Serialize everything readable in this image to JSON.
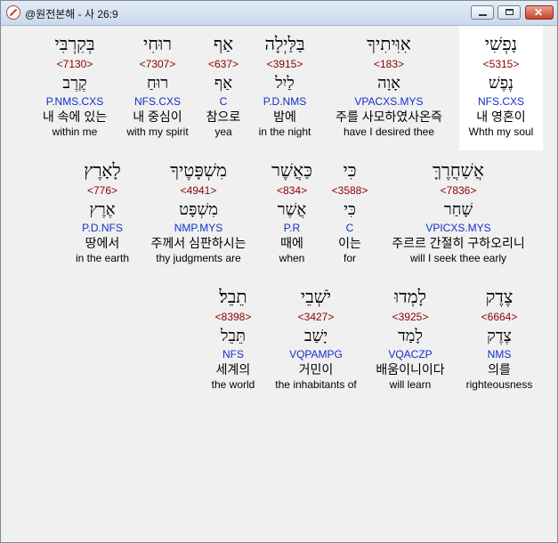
{
  "window": {
    "title": "@원전본해 - 사 26:9"
  },
  "rows": [
    [
      {
        "heb": "בְּקִרְבִּי",
        "num": "<7130>",
        "root": "קֶרֶב",
        "parse": "P.NMS.CXS",
        "kor": "내 속에 있는",
        "eng": "within me"
      },
      {
        "heb": "רוּחִי",
        "num": "<7307>",
        "root": "רוּחַ",
        "parse": "NFS.CXS",
        "kor": "내 중심이",
        "eng": "with my spirit"
      },
      {
        "heb": "אַף",
        "num": "<637>",
        "root": "אַף",
        "parse": "C",
        "kor": "참으로",
        "eng": "yea"
      },
      {
        "heb": "בַּלַּיְלָה",
        "num": "<3915>",
        "root": "לַיִל",
        "parse": "P.D.NMS",
        "kor": "밤에",
        "eng": "in the night"
      },
      {
        "heb": "אִוִּיתִיךָ",
        "num": "<183>",
        "root": "אָוָה",
        "parse": "VPACXS.MYS",
        "kor": "주를 사모하였사온즉",
        "eng": "have I desired thee"
      },
      {
        "heb": "נַפְשִׁי",
        "num": "<5315>",
        "root": "נֶפֶשׁ",
        "parse": "NFS.CXS",
        "kor": "내 영혼이",
        "eng": "Whth my soul"
      }
    ],
    [
      {
        "heb": "לָאָרֶץ",
        "num": "<776>",
        "root": "אֶרֶץ",
        "parse": "P.D.NFS",
        "kor": "땅에서",
        "eng": "in the earth"
      },
      {
        "heb": "מִשְׁפָּטֶיךָ",
        "num": "<4941>",
        "root": "מִשְׁפָּט",
        "parse": "NMP.MYS",
        "kor": "주께서 심판하시는",
        "eng": "thy judgments are"
      },
      {
        "heb": "כַּאֲשֶׁר",
        "num": "<834>",
        "root": "אֲשֶׁר",
        "parse": "P.R",
        "kor": "때에",
        "eng": "when"
      },
      {
        "heb": "כִּי",
        "num": "<3588>",
        "root": "כִּי",
        "parse": "C",
        "kor": "이는",
        "eng": "for"
      },
      {
        "heb": "אֲשַׁחֲרֶךָּ",
        "num": "<7836>",
        "root": "שָׁחַר",
        "parse": "VPICXS.MYS",
        "kor": "주르르 간절히 구하오리니",
        "eng": "will I seek thee early"
      }
    ],
    [
      {
        "heb": "תֵבֵל׃",
        "num": "<8398>",
        "root": "תֵּבֵל",
        "parse": "NFS",
        "kor": "세계의",
        "eng": "the world"
      },
      {
        "heb": "יֹשְׁבֵי",
        "num": "<3427>",
        "root": "יָשַׁב",
        "parse": "VQPAMPG",
        "kor": "거민이",
        "eng": "the inhabitants of"
      },
      {
        "heb": "לָמְדוּ",
        "num": "<3925>",
        "root": "לָמַד",
        "parse": "VQACZP",
        "kor": "배움이니이다",
        "eng": "will learn"
      },
      {
        "heb": "צֶדֶק",
        "num": "<6664>",
        "root": "צֶדֶק",
        "parse": "NMS",
        "kor": "의를",
        "eng": "righteousness"
      }
    ]
  ]
}
